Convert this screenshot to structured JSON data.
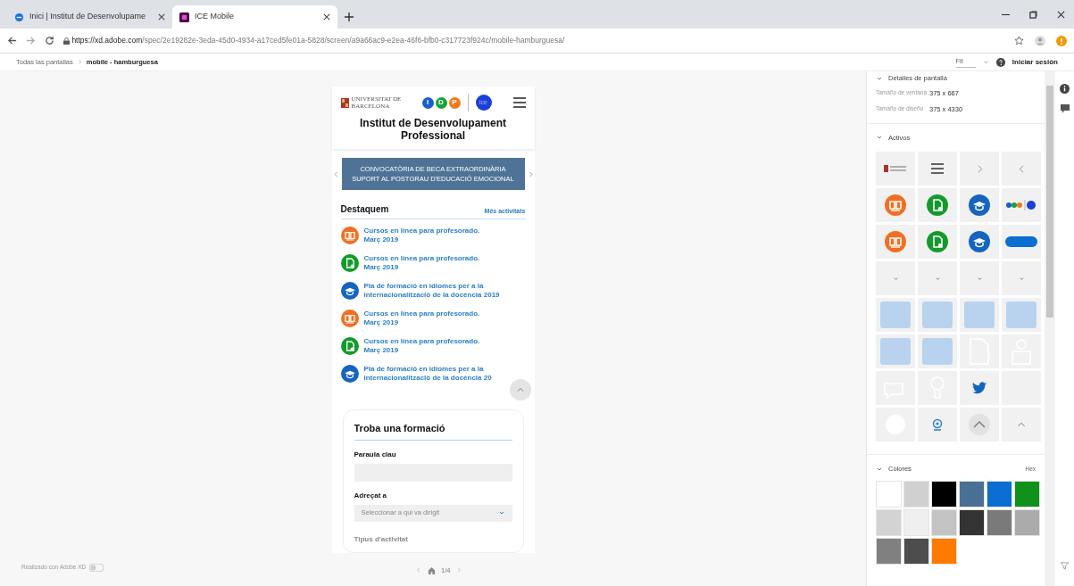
{
  "browser": {
    "tabs": [
      {
        "title": "Inici | Institut de Desenvolupame",
        "kind": "globe",
        "selected": false
      },
      {
        "title": "ICE Mobile",
        "kind": "xd",
        "selected": true
      }
    ],
    "url_host": "https://xd.adobe.com",
    "url_path": "/spec/2e19282e-3eda-45d0-4934-a17ced5fe01a-5828/screen/a9a66ac9-e2ea-46f6-bfb0-c317723f924c/mobile-hamburguesa/"
  },
  "xd_bar": {
    "breadcrumb": [
      {
        "label": "Todas las pantallas",
        "current": false
      },
      {
        "label": "mobile - hamburguesa",
        "current": true
      }
    ],
    "zoom": "Fit",
    "signin": "Iniciar sesión"
  },
  "mockup": {
    "logo_lines": [
      "UNIVERSITAT DE",
      "BARCELONA"
    ],
    "idp_letters": [
      "I",
      "D",
      "P"
    ],
    "ice": "ice",
    "title": "Institut de Desenvolupament Professional",
    "banner_lines": [
      "CONVOCATÒRIA DE BECA EXTRAORDINÀRIA",
      "SUPORT AL POSTGRAU D'EDUCACIÓ EMOCIONAL"
    ],
    "section": "Destaquem",
    "more_link": "Més activitats",
    "items": [
      {
        "kind": "book",
        "lines": [
          "Cursos en línea para profesorado.",
          "Març 2019"
        ]
      },
      {
        "kind": "doc",
        "lines": [
          "Cursos en línea para profesorado.",
          "Març 2019"
        ]
      },
      {
        "kind": "cap",
        "lines": [
          "Pla de formació en idiomes per a la",
          "internacionalització de la docència 2019"
        ]
      },
      {
        "kind": "book",
        "lines": [
          "Cursos en línea para profesorado.",
          "Març 2019"
        ]
      },
      {
        "kind": "doc",
        "lines": [
          "Cursos en línea para profesorado.",
          "Març 2019"
        ]
      },
      {
        "kind": "cap",
        "lines": [
          "Pla de formació en idiomes per a la",
          "internacionalització de la docència 20"
        ]
      }
    ],
    "form": {
      "title": "Troba una formació",
      "fields": [
        {
          "kind": "text",
          "label": "Paraula clau"
        },
        {
          "kind": "select",
          "label": "Adreçat a",
          "placeholder": "Seleccionar a qui va dirigit"
        }
      ],
      "faded_label": "Tipus d'activitat"
    },
    "pager": "1/4"
  },
  "footer": "Realizado con Adobe XD",
  "panel": {
    "details": {
      "title": "Detalles de pantalla",
      "expanded": true,
      "rows": [
        {
          "label": "Tamaño de ventana",
          "value": "375 x 667"
        },
        {
          "label": "Tamaño de diseño",
          "value": "375 x 4330"
        }
      ]
    },
    "assets": {
      "title": "Activos",
      "expanded": true,
      "items": [
        {
          "kind": "logo"
        },
        {
          "kind": "menu"
        },
        {
          "kind": "chevron-right"
        },
        {
          "kind": "chevron-left"
        },
        {
          "kind": "book"
        },
        {
          "kind": "doc"
        },
        {
          "kind": "cap"
        },
        {
          "kind": "logos"
        },
        {
          "kind": "book"
        },
        {
          "kind": "doc"
        },
        {
          "kind": "cap"
        },
        {
          "kind": "pill"
        },
        {
          "kind": "chevron-down"
        },
        {
          "kind": "chevron-down"
        },
        {
          "kind": "chevron-down"
        },
        {
          "kind": "chevron-down"
        },
        {
          "kind": "tile"
        },
        {
          "kind": "tile"
        },
        {
          "kind": "tile"
        },
        {
          "kind": "tile"
        },
        {
          "kind": "tile"
        },
        {
          "kind": "tile"
        },
        {
          "kind": "doc-outline"
        },
        {
          "kind": "person-outline"
        },
        {
          "kind": "chat-outline"
        },
        {
          "kind": "bulb-outline"
        },
        {
          "kind": "bird"
        },
        {
          "kind": "blank"
        },
        {
          "kind": "circle"
        },
        {
          "kind": "pin"
        },
        {
          "kind": "up-circle"
        },
        {
          "kind": "up"
        }
      ]
    },
    "colors": {
      "title": "Colores",
      "expanded": true,
      "format": "Hex",
      "swatches": [
        {
          "color": "#ffffff"
        },
        {
          "color": "#d0d0d0"
        },
        {
          "color": "#000000"
        },
        {
          "color": "#4a6f94"
        },
        {
          "color": "#0b6fd1"
        },
        {
          "color": "#10921a"
        },
        {
          "color": "#d3d3d3"
        },
        {
          "color": "#efefef"
        },
        {
          "color": "#c3c3c3"
        },
        {
          "color": "#333333"
        },
        {
          "color": "#7a7a7a"
        },
        {
          "color": "#ababab"
        },
        {
          "color": "#808080"
        },
        {
          "color": "#4d4d4d"
        },
        {
          "color": "#ff7a00"
        }
      ]
    }
  }
}
